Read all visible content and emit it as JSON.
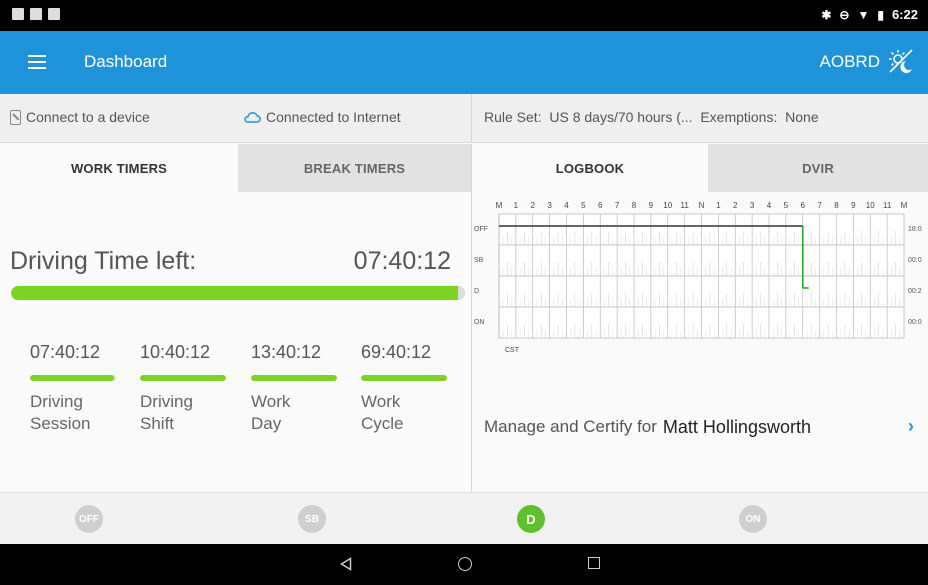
{
  "status_bar": {
    "time": "6:22"
  },
  "app_bar": {
    "title": "Dashboard",
    "mode": "AOBRD"
  },
  "info_bar": {
    "device": "Connect to a device",
    "internet": "Connected to Internet",
    "rule_set": "Rule Set:  US 8 days/70 hours (...  Exemptions:  None"
  },
  "left_tabs": [
    {
      "label": "WORK TIMERS",
      "active": true
    },
    {
      "label": "BREAK TIMERS",
      "active": false
    }
  ],
  "driving": {
    "label": "Driving Time left:",
    "value": "07:40:12",
    "progress": 0.985
  },
  "timers": [
    {
      "value": "07:40:12",
      "label": "Driving\nSession",
      "progress": 0.98
    },
    {
      "value": "10:40:12",
      "label": "Driving\nShift",
      "progress": 1.0
    },
    {
      "value": "13:40:12",
      "label": "Work\nDay",
      "progress": 1.0
    },
    {
      "value": "69:40:12",
      "label": "Work\nCycle",
      "progress": 1.0
    }
  ],
  "right_tabs": [
    {
      "label": "LOGBOOK",
      "active": true
    },
    {
      "label": "DVIR",
      "active": false
    }
  ],
  "logbook": {
    "hours": [
      "M",
      "1",
      "2",
      "3",
      "4",
      "5",
      "6",
      "7",
      "8",
      "9",
      "10",
      "11",
      "N",
      "1",
      "2",
      "3",
      "4",
      "5",
      "6",
      "7",
      "8",
      "9",
      "10",
      "11",
      "M"
    ],
    "rows": [
      "OFF",
      "SB",
      "D",
      "ON"
    ],
    "totals": [
      "18:0",
      "00:0",
      "00:2",
      "00:0"
    ],
    "timezone": "CST",
    "segments": [
      {
        "status": "OFF",
        "from": 0,
        "to": 18.0
      },
      {
        "status": "D",
        "from": 18.0,
        "to": 18.35
      }
    ]
  },
  "manage": {
    "text": "Manage and Certify for",
    "name": "Matt Hollingsworth"
  },
  "duty_buttons": [
    {
      "label": "OFF",
      "active": false
    },
    {
      "label": "SB",
      "active": false
    },
    {
      "label": "D",
      "active": true
    },
    {
      "label": "ON",
      "active": false
    }
  ],
  "colors": {
    "accent": "#1e93d9",
    "progress": "#7ed321",
    "active_duty": "#5dc12e",
    "graph_line": "#333333",
    "graph_drive": "#2aa52a"
  }
}
